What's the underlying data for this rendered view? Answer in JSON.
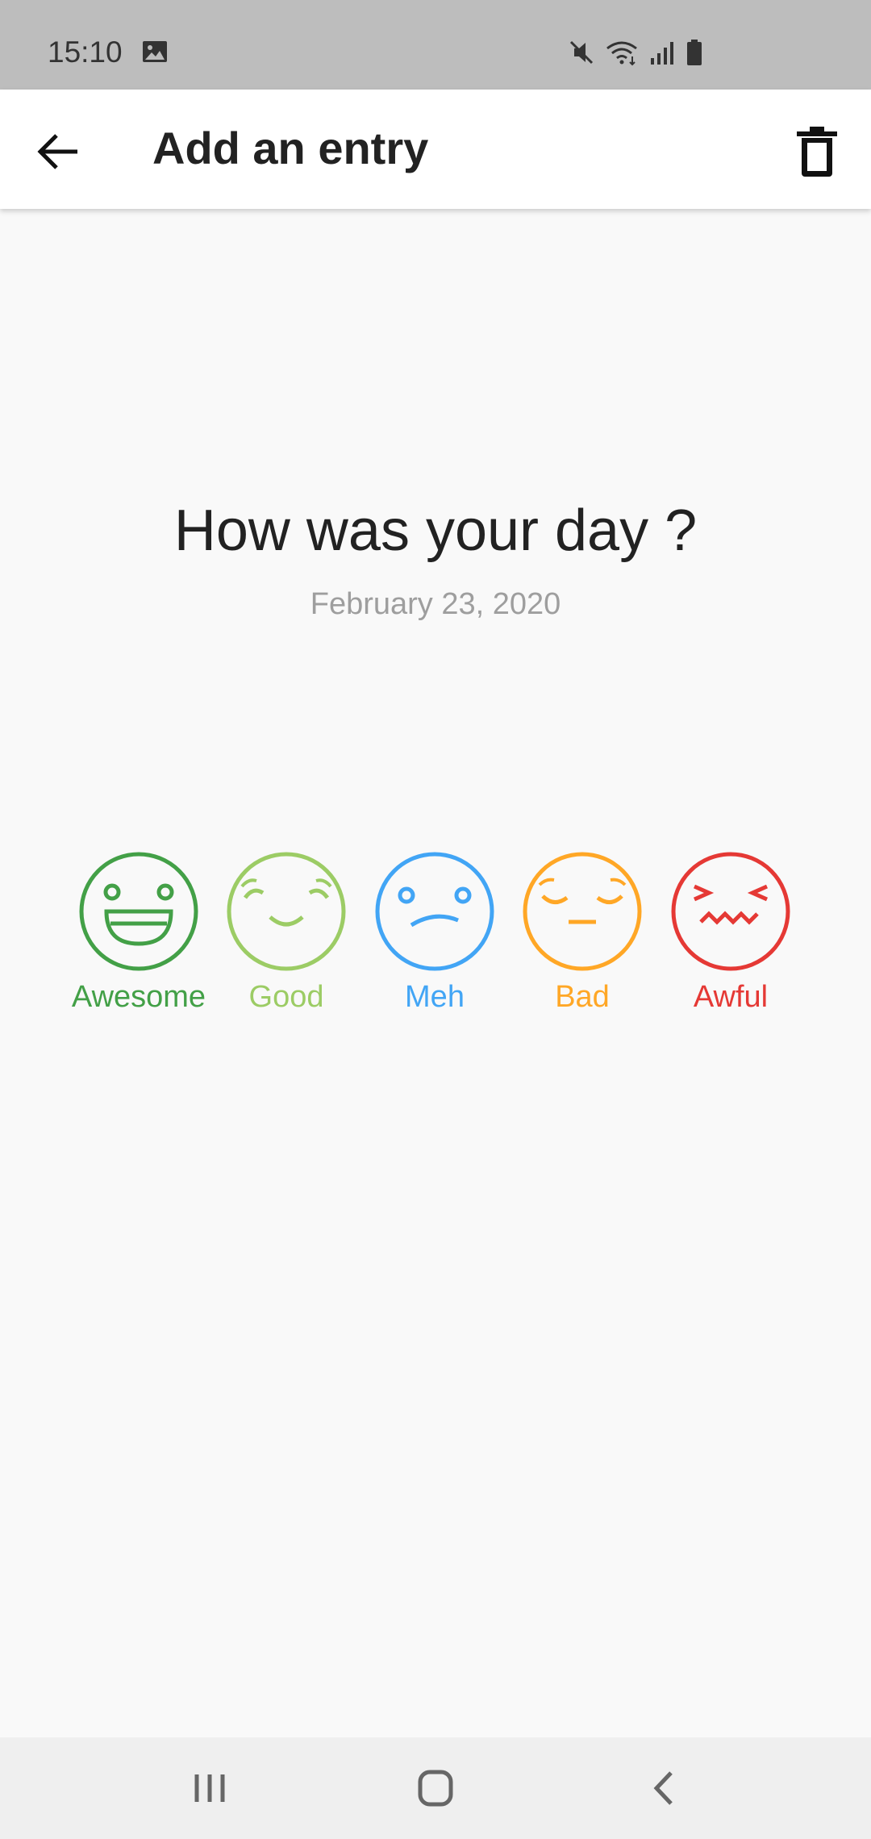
{
  "status_bar": {
    "time": "15:10",
    "icons": [
      "image-notification-icon",
      "mute-icon",
      "wifi-icon",
      "signal-icon",
      "battery-icon"
    ]
  },
  "app_bar": {
    "title": "Add an entry",
    "back_icon": "arrow-back-icon",
    "delete_icon": "trash-icon"
  },
  "prompt": {
    "question": "How was your day ?",
    "date": "February 23, 2020"
  },
  "moods": [
    {
      "label": "Awesome",
      "icon": "awesome-face-icon",
      "color": "#43a047"
    },
    {
      "label": "Good",
      "icon": "good-face-icon",
      "color": "#9ccc65"
    },
    {
      "label": "Meh",
      "icon": "meh-face-icon",
      "color": "#42a5f5"
    },
    {
      "label": "Bad",
      "icon": "bad-face-icon",
      "color": "#ffa726"
    },
    {
      "label": "Awful",
      "icon": "awful-face-icon",
      "color": "#e53935"
    }
  ],
  "nav_bar": {
    "icons": [
      "recent-apps-icon",
      "home-icon",
      "back-nav-icon"
    ]
  }
}
